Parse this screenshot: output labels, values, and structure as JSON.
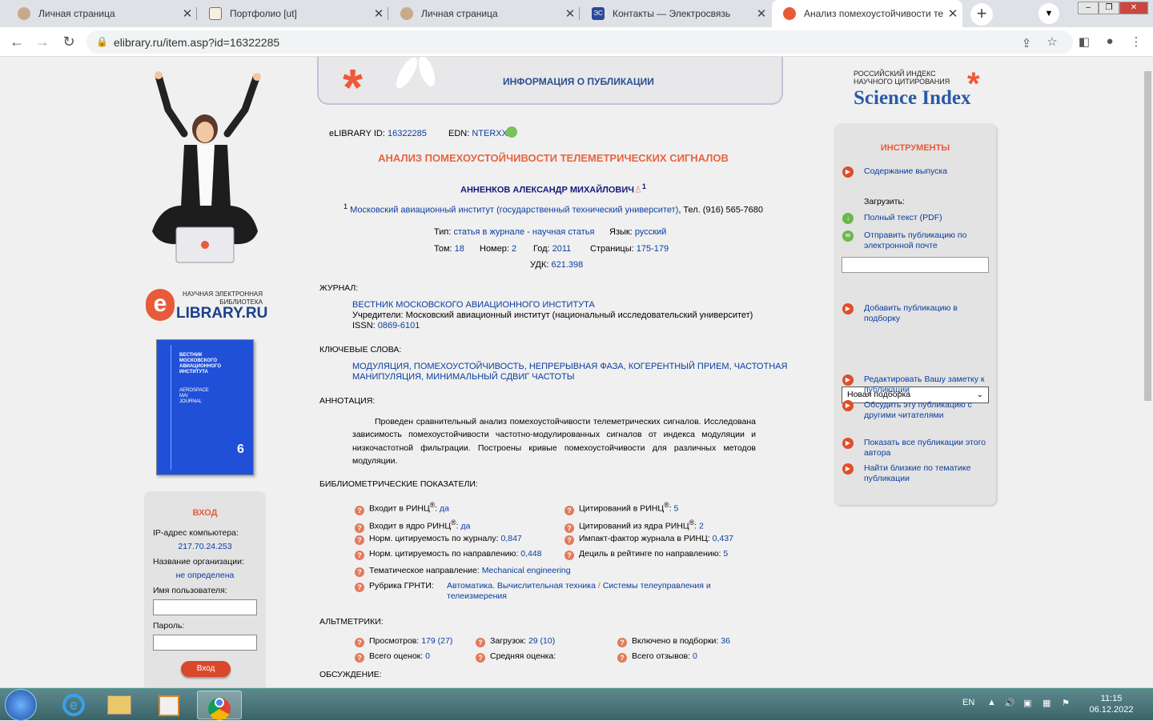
{
  "browser": {
    "tabs": [
      {
        "label": "Личная страница",
        "active": false
      },
      {
        "label": "Портфолио [ut]",
        "active": false
      },
      {
        "label": "Личная страница",
        "active": false
      },
      {
        "label": "Контакты — Электросвязь",
        "active": false
      },
      {
        "label": "Анализ помехоустойчивости те",
        "active": true
      }
    ],
    "url": "elibrary.ru/item.asp?id=16322285"
  },
  "left": {
    "logo": {
      "line1": "НАУЧНАЯ ЭЛЕКТРОННАЯ",
      "line2": "БИБЛИОТЕКА",
      "name": "LIBRARY.RU",
      "letter": "e"
    },
    "cover": {
      "title": "ВЕСТНИК МОСКОВСКОГО АВИАЦИОННОГО ИНСТИТУТА",
      "eng": "AEROSPACE MAI JOURNAL",
      "num": "6"
    },
    "login": {
      "title": "ВХОД",
      "ip_label": "IP-адрес компьютера:",
      "ip_value": "217.70.24.253",
      "org_label": "Название организации:",
      "org_value": "не определена",
      "user_label": "Имя пользователя:",
      "pass_label": "Пароль:",
      "button": "Вход"
    }
  },
  "banner": {
    "title": "ИНФОРМАЦИЯ О ПУБЛИКАЦИИ"
  },
  "pub": {
    "elib_label": "eLIBRARY ID:",
    "elib_id": "16322285",
    "edn_label": "EDN:",
    "edn": "NTERXX",
    "title": "АНАЛИЗ ПОМЕХОУСТОЙЧИВОСТИ ТЕЛЕМЕТРИЧЕСКИХ СИГНАЛОВ",
    "author": "АННЕНКОВ АЛЕКСАНДР МИХАЙЛОВИЧ",
    "author_sup": "1",
    "affil_sup": "1",
    "affil_org": "Московский авиационный институт (государственный технический университет)",
    "affil_tel": ", Тел. (916) 565-7680",
    "type_label": "Тип:",
    "type_value": "статья в журнале - научная статья",
    "lang_label": "Язык:",
    "lang_value": "русский",
    "vol_label": "Том:",
    "vol_value": "18",
    "num_label": "Номер:",
    "num_value": "2",
    "year_label": "Год:",
    "year_value": "2011",
    "pages_label": "Страницы:",
    "pages_value": "175-179",
    "udk_label": "УДК:",
    "udk_value": "621.398",
    "journal_label": "ЖУРНАЛ:",
    "journal_name": "ВЕСТНИК МОСКОВСКОГО АВИАЦИОННОГО ИНСТИТУТА",
    "founder_label": "Учредители:",
    "founder_value": "Московский авиационный институт (национальный исследовательский университет)",
    "issn_label": "ISSN:",
    "issn_value": "0869-6101",
    "kw_label": "КЛЮЧЕВЫЕ СЛОВА:",
    "kw_line1": "МОДУЛЯЦИЯ, ПОМЕХОУСТОЙЧИВОСТЬ, НЕПРЕРЫВНАЯ ФАЗА, КОГЕРЕНТНЫЙ ПРИЕМ, ЧАСТОТНАЯ",
    "kw_line2": "МАНИПУЛЯЦИЯ, МИНИМАЛЬНЫЙ СДВИГ ЧАСТОТЫ",
    "abs_label": "АННОТАЦИЯ:",
    "abstract": "Проведен сравнительный анализ помехоустойчивости телеметрических сигналов. Исследована зависимость помехоустойчивости частотно-модулированных сигналов от индекса модуляции и низкочастотной фильтрации. Построены кривые помехоустойчивости для различных методов модуляции.",
    "biblio_label": "БИБЛИОМЕТРИЧЕСКИЕ ПОКАЗАТЕЛИ:",
    "m1_l": "Входит в РИНЦ",
    "m1_v": "да",
    "m2_l": "Цитирований в РИНЦ",
    "m2_v": "5",
    "m3_l": "Входит в ядро РИНЦ",
    "m3_v": "да",
    "m4_l": "Цитирований из ядра РИНЦ",
    "m4_v": "2",
    "m5_l": "Норм. цитируемость по журналу:",
    "m5_v": "0,847",
    "m6_l": "Импакт-фактор журнала в РИНЦ:",
    "m6_v": "0,437",
    "m7_l": "Норм. цитируемость по направлению:",
    "m7_v": "0,448",
    "m8_l": "Дециль в рейтинге по направлению:",
    "m8_v": "5",
    "m9_l": "Тематическое направление:",
    "m9_v": "Mechanical engineering",
    "m10_l": "Рубрика ГРНТИ:",
    "m10_v1": "Автоматика. Вычислительная техника",
    "m10_sep": "/",
    "m10_v2": "Системы телеуправления и",
    "m10_v3": "телеизмерения",
    "reg": "®",
    "alt_label": "АЛЬТМЕТРИКИ:",
    "a1_l": "Просмотров:",
    "a1_v": "179 (27)",
    "a2_l": "Загрузок:",
    "a2_v": "29 (10)",
    "a3_l": "Включено в подборки:",
    "a3_v": "36",
    "a4_l": "Всего оценок:",
    "a4_v": "0",
    "a5_l": "Средняя оценка:",
    "a6_l": "Всего отзывов:",
    "a6_v": "0",
    "disc_label": "ОБСУЖДЕНИЕ:"
  },
  "right": {
    "si_line1": "РОССИЙСКИЙ ИНДЕКС",
    "si_line2": "НАУЧНОГО ЦИТИРОВАНИЯ",
    "si_name": "Science Index",
    "tools_title": "ИНСТРУМЕНТЫ",
    "t_contents": "Содержание выпуска",
    "t_load": "Загрузить:",
    "t_pdf": "Полный текст (PDF)",
    "t_email": "Отправить публикацию по электронной почте",
    "t_add": "Добавить публикацию в подборку",
    "t_select": "Новая подборка",
    "t_note": "Редактировать Вашу заметку к публикации",
    "t_discuss": "Обсудить эту публикацию с другими читателями",
    "t_author": "Показать все публикации этого автора",
    "t_similar": "Найти близкие по тематике публикации"
  },
  "taskbar": {
    "lang": "EN",
    "time": "11:15",
    "date": "06.12.2022"
  }
}
